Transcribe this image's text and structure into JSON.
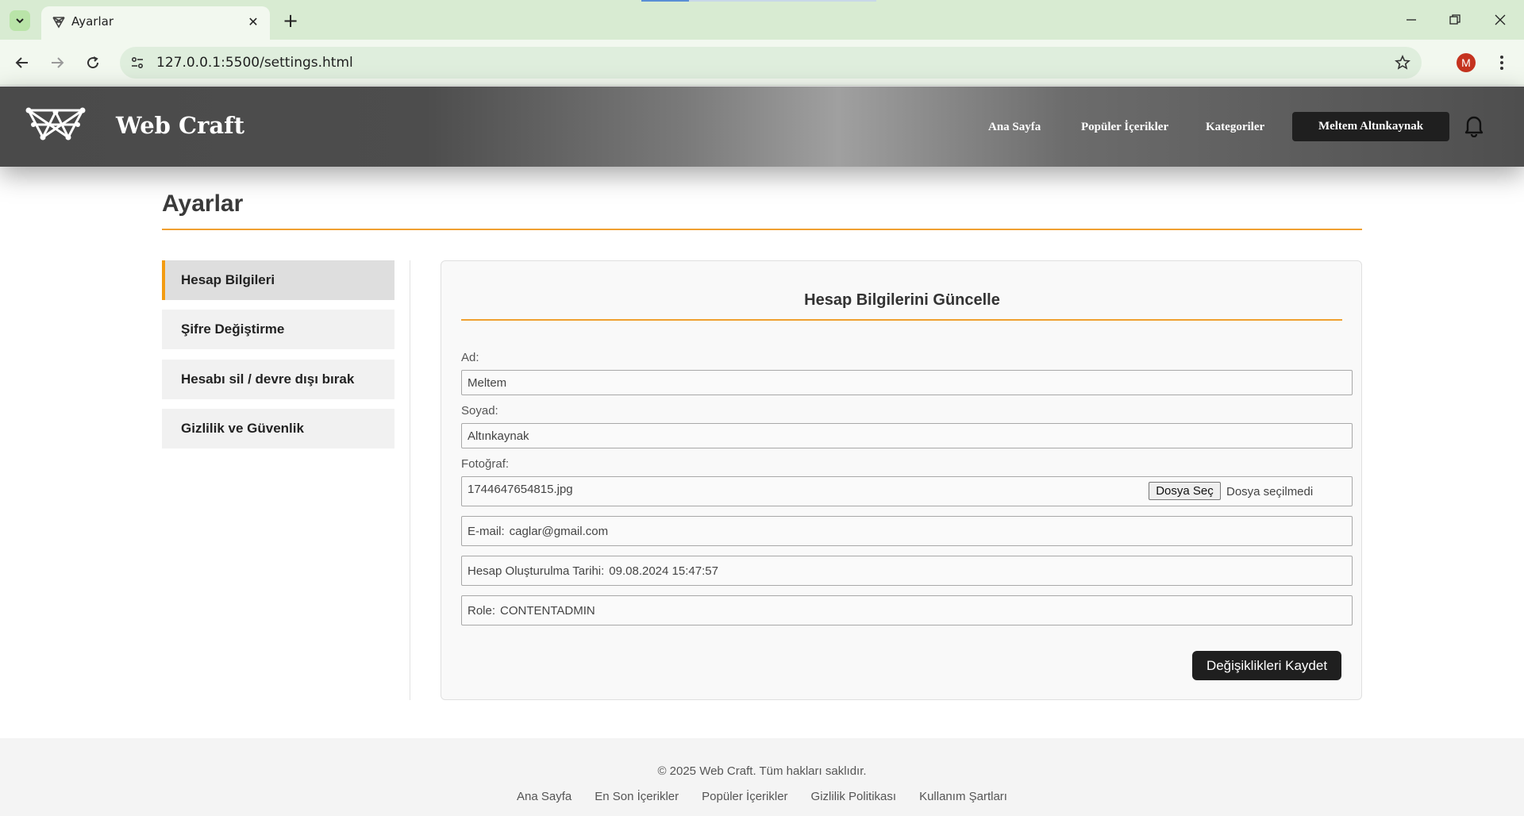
{
  "browser": {
    "tab_title": "Ayarlar",
    "tab_close": "✕",
    "new_tab": "+",
    "url": "127.0.0.1:5500/settings.html",
    "profile_initial": "M"
  },
  "header": {
    "brand": "Web Craft",
    "nav": [
      "Ana Sayfa",
      "Popüler İçerikler",
      "Kategoriler"
    ],
    "user_name": "Meltem Altınkaynak"
  },
  "page": {
    "title": "Ayarlar"
  },
  "sidebar": {
    "items": [
      {
        "label": "Hesap Bilgileri",
        "active": true
      },
      {
        "label": "Şifre Değiştirme",
        "active": false
      },
      {
        "label": "Hesabı sil / devre dışı bırak",
        "active": false
      },
      {
        "label": "Gizlilik ve Güvenlik",
        "active": false
      }
    ]
  },
  "form": {
    "title": "Hesap Bilgilerini Güncelle",
    "first_name_label": "Ad:",
    "first_name_value": "Meltem",
    "last_name_label": "Soyad:",
    "last_name_value": "Altınkaynak",
    "photo_label": "Fotoğraf:",
    "photo_current": "1744647654815.jpg",
    "file_button": "Dosya Seç",
    "file_status": "Dosya seçilmedi",
    "email_label": "E-mail:",
    "email_value": "caglar@gmail.com",
    "created_label": "Hesap Oluşturulma Tarihi:",
    "created_value": "09.08.2024 15:47:57",
    "role_label": "Role:",
    "role_value": "CONTENTADMIN",
    "save_button": "Değişiklikleri Kaydet"
  },
  "footer": {
    "copyright": "© 2025 Web Craft. Tüm hakları saklıdır.",
    "links": [
      "Ana Sayfa",
      "En Son İçerikler",
      "Popüler İçerikler",
      "Gizlilik Politikası",
      "Kullanım Şartları"
    ]
  },
  "colors": {
    "accent": "#f0a030",
    "dark_button": "#1f1f1f"
  }
}
